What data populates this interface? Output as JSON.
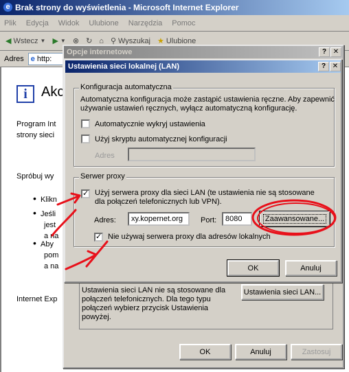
{
  "ie": {
    "title": "Brak strony do wyświetlenia - Microsoft Internet Explorer",
    "menu": [
      "Plik",
      "Edycja",
      "Widok",
      "Ulubione",
      "Narzędzia",
      "Pomoc"
    ],
    "toolbar": {
      "back": "Wstecz",
      "search": "Wyszukaj",
      "favorites": "Ulubione"
    },
    "address_label": "Adres",
    "address_value": "http:",
    "page": {
      "heading": "Akc",
      "para1_line1": "Program Int",
      "para1_line2": "strony sieci",
      "try_line": "Spróbuj wy",
      "bullet1": "Klikn",
      "bullet2_l1": "Jeśli",
      "bullet2_l2": "jest",
      "bullet2_l3": "a na",
      "bullet3_l1": "Aby",
      "bullet3_l2": "pom",
      "bullet3_l3": "a na",
      "footer": "Internet Exp"
    }
  },
  "options_dialog": {
    "title": "Opcje internetowe",
    "lan_note": "Ustawienia sieci LAN nie są stosowane dla połączeń telefonicznych. Dla tego typu połączeń wybierz przycisk Ustawienia powyżej.",
    "lan_note_l1": "Ustawienia sieci LAN nie są stosowane dla",
    "lan_note_l2": "połączeń telefonicznych. Dla tego typu",
    "lan_note_l3": "połączeń wybierz przycisk Ustawienia",
    "lan_note_l4": "powyżej.",
    "lan_settings_button": "Ustawienia sieci LAN...",
    "ok": "OK",
    "cancel": "Anuluj",
    "apply": "Zastosuj"
  },
  "lan_dialog": {
    "title": "Ustawienia sieci lokalnej (LAN)",
    "auto_group": "Konfiguracja automatyczna",
    "auto_desc_l1": "Automatyczna konfiguracja może zastąpić ustawienia ręczne. Aby zapewnić",
    "auto_desc_l2": "używanie ustawień ręcznych, wyłącz automatyczną konfigurację.",
    "auto_detect": {
      "label": "Automatycznie wykryj ustawienia",
      "checked": false
    },
    "auto_script": {
      "label": "Użyj skryptu automatycznej konfiguracji",
      "checked": false
    },
    "address_label": "Adres",
    "address_value": "",
    "proxy_group": "Serwer proxy",
    "use_proxy": {
      "label_l1": "Użyj serwera proxy dla sieci LAN (te ustawienia nie są stosowane",
      "label_l2": "dla połączeń telefonicznych lub VPN).",
      "checked": true
    },
    "proxy_address_label": "Adres:",
    "proxy_address_value": "xy.kopernet.org",
    "port_label": "Port:",
    "port_value": "8080",
    "advanced_button": "Zaawansowane...",
    "bypass_local": {
      "label": "Nie używaj serwera proxy dla adresów lokalnych",
      "checked": true
    },
    "ok": "OK",
    "cancel": "Anuluj"
  },
  "colors": {
    "annotation": "#e8101a",
    "titlebar_active": "#0a246a",
    "dialog_bg": "#d4d0c8"
  }
}
